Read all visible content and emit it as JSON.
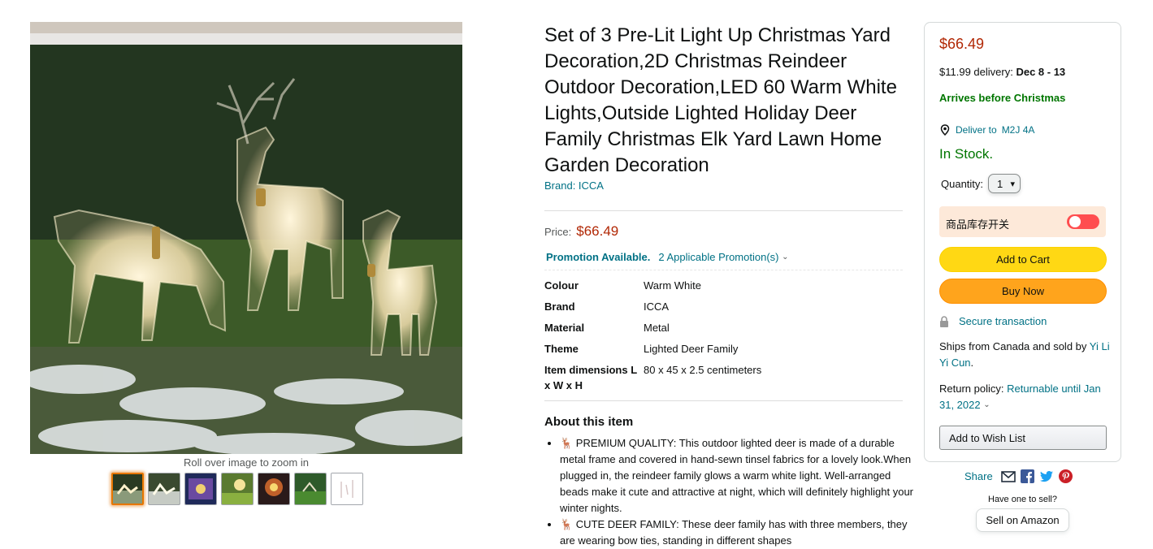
{
  "gallery": {
    "zoom_hint": "Roll over image to zoom in",
    "thumbnail_count": 7,
    "selected_thumbnail": 1
  },
  "product": {
    "title": "Set of 3 Pre-Lit Light Up Christmas Yard Decoration,2D Christmas Reindeer Outdoor Decoration,LED 60 Warm White Lights,Outside Lighted Holiday Deer Family Christmas Elk Yard Lawn Home Garden Decoration",
    "brand_link": "Brand: ICCA",
    "price_label": "Price:",
    "price": "$66.49",
    "promo_label": "Promotion Available.",
    "promo_count": "2 Applicable Promotion(s)",
    "specs": [
      {
        "key": "Colour",
        "value": "Warm White"
      },
      {
        "key": "Brand",
        "value": "ICCA"
      },
      {
        "key": "Material",
        "value": "Metal"
      },
      {
        "key": "Theme",
        "value": "Lighted Deer Family"
      },
      {
        "key": "Item dimensions L x W x H",
        "value": "80 x 45 x 2.5 centimeters"
      }
    ],
    "about_heading": "About this item",
    "about_items": [
      "🦌 PREMIUM QUALITY: This outdoor lighted deer is made of a durable metal frame and covered in hand-sewn tinsel fabrics for a lovely look.When plugged in, the reindeer family glows a warm white light. Well-arranged beads make it cute and attractive at night, which will definitely highlight your winter nights.",
      "🦌 CUTE DEER FAMILY: These deer family has with three members, they are wearing bow ties, standing in different shapes"
    ]
  },
  "buybox": {
    "price": "$66.49",
    "delivery_prefix": "$11.99 delivery:",
    "delivery_dates": "Dec 8 - 13",
    "arrives": "Arrives before Christmas",
    "deliver_to_label": "Deliver to",
    "deliver_to_code": "M2J 4A",
    "stock": "In Stock.",
    "quantity_label": "Quantity:",
    "quantity_value": "1",
    "stock_toggle_label": "商品库存开关",
    "stock_toggle_on": false,
    "add_to_cart": "Add to Cart",
    "buy_now": "Buy Now",
    "secure": "Secure transaction",
    "ships_text": "Ships from Canada and sold by",
    "seller": "Yi Li Yi Cun",
    "seller_suffix": ".",
    "return_label": "Return policy:",
    "return_value": "Returnable until Jan 31, 2022",
    "wish_list": "Add to Wish List"
  },
  "share": {
    "label": "Share",
    "icons": [
      "email-icon",
      "facebook-icon",
      "twitter-icon",
      "pinterest-icon"
    ]
  },
  "sell": {
    "question": "Have one to sell?",
    "button": "Sell on Amazon"
  },
  "colors": {
    "price_red": "#b12704",
    "link_teal": "#007185",
    "stock_green": "#007600",
    "cart_yellow": "#ffd814",
    "buy_orange": "#ffa41c",
    "toggle_red": "#ff4d4f"
  }
}
